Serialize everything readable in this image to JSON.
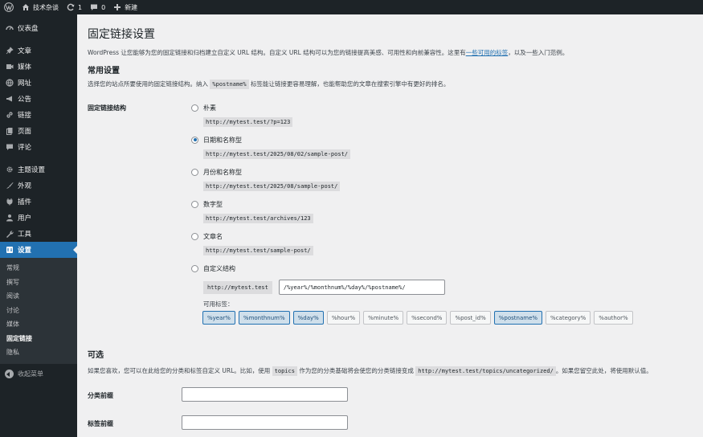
{
  "adminbar": {
    "site_name": "技术杂谈",
    "updates_count": "1",
    "comments_count": "0",
    "new_label": "新建"
  },
  "sidebar": {
    "top_items": [
      {
        "label": "仪表盘",
        "icon": "dashboard-icon"
      }
    ],
    "content_items": [
      {
        "label": "文章",
        "icon": "pin-icon"
      },
      {
        "label": "媒体",
        "icon": "media-icon"
      },
      {
        "label": "网址",
        "icon": "globe-icon"
      },
      {
        "label": "公告",
        "icon": "megaphone-icon"
      },
      {
        "label": "链接",
        "icon": "link-icon"
      },
      {
        "label": "页面",
        "icon": "page-icon"
      },
      {
        "label": "评论",
        "icon": "comment-icon"
      }
    ],
    "settings_items": [
      {
        "label": "主题设置",
        "icon": "gear-icon"
      },
      {
        "label": "外观",
        "icon": "brush-icon"
      },
      {
        "label": "插件",
        "icon": "plugin-icon"
      },
      {
        "label": "用户",
        "icon": "user-icon"
      },
      {
        "label": "工具",
        "icon": "wrench-icon"
      },
      {
        "label": "设置",
        "icon": "settings-icon"
      }
    ],
    "submenu": [
      "常规",
      "撰写",
      "阅读",
      "讨论",
      "媒体",
      "固定链接",
      "隐私"
    ],
    "collapse_label": "收起菜单"
  },
  "page": {
    "title": "固定链接设置",
    "intro_text": "WordPress 让您能够为您的固定链接和归档建立自定义 URL 结构。自定义 URL 结构可以为您的链接提高美感、可用性和向前兼容性。这里有",
    "intro_link": "一些可用的标签",
    "intro_tail": "，以及一些入门范例。",
    "common_title": "常用设置",
    "common_desc_pre": "选择您的站点所要使用的固定链接结构。纳入",
    "common_desc_code": "%postname%",
    "common_desc_post": "标签能让链接更容易理解，也能帮助您的文章在搜索引擎中有更好的排名。",
    "structure_label": "固定链接结构",
    "options": [
      {
        "label": "朴素",
        "sample": "http://mytest.test/?p=123",
        "checked": false
      },
      {
        "label": "日期和名称型",
        "sample": "http://mytest.test/2025/08/02/sample-post/",
        "checked": true
      },
      {
        "label": "月份和名称型",
        "sample": "http://mytest.test/2025/08/sample-post/",
        "checked": false
      },
      {
        "label": "数字型",
        "sample": "http://mytest.test/archives/123",
        "checked": false
      },
      {
        "label": "文章名",
        "sample": "http://mytest.test/sample-post/",
        "checked": false
      }
    ],
    "custom": {
      "label": "自定义结构",
      "prefix": "http://mytest.test",
      "value": "/%year%/%monthnum%/%day%/%postname%/",
      "tags_label": "可用标签：",
      "tags": [
        {
          "text": "%year%",
          "active": true
        },
        {
          "text": "%monthnum%",
          "active": true
        },
        {
          "text": "%day%",
          "active": true
        },
        {
          "text": "%hour%",
          "active": false
        },
        {
          "text": "%minute%",
          "active": false
        },
        {
          "text": "%second%",
          "active": false
        },
        {
          "text": "%post_id%",
          "active": false
        },
        {
          "text": "%postname%",
          "active": true
        },
        {
          "text": "%category%",
          "active": false
        },
        {
          "text": "%author%",
          "active": false
        }
      ]
    },
    "optional_title": "可选",
    "optional_desc_a": "如果您喜欢，您可以在此给您的分类和标签自定义 URL。比如，使用",
    "optional_desc_code1": "topics",
    "optional_desc_b": "作为您的分类基础将会使您的分类链接变成",
    "optional_desc_code2": "http://mytest.test/topics/uncategorized/",
    "optional_desc_c": "。如果您留空此处，将使用默认值。",
    "category_base_label": "分类前缀",
    "category_base_value": "",
    "tag_base_label": "标签前缀",
    "tag_base_value": ""
  },
  "colors": {
    "admin_dark": "#1d2327",
    "accent": "#2271b1",
    "background": "#f0f0f1"
  }
}
